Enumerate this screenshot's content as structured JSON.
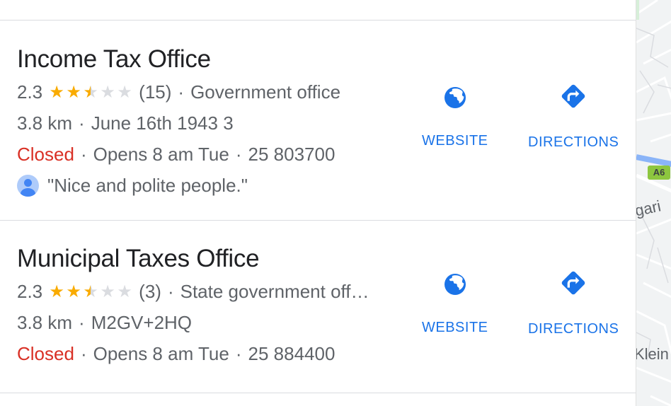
{
  "results": [
    {
      "name": "Income Tax Office",
      "rating": "2.3",
      "stars": [
        "full",
        "full",
        "half",
        "empty",
        "empty"
      ],
      "reviews": "(15)",
      "category": "Government office",
      "distance": "3.8 km",
      "address": "June 16th 1943 3",
      "status": "Closed",
      "hours": "Opens 8 am Tue",
      "phone": "25 803700",
      "review_snippet": "\"Nice and polite people.\"",
      "website_label": "WEBSITE",
      "directions_label": "DIRECTIONS"
    },
    {
      "name": "Municipal Taxes Office",
      "rating": "2.3",
      "stars": [
        "full",
        "full",
        "half",
        "empty",
        "empty"
      ],
      "reviews": "(3)",
      "category": "State government off…",
      "distance": "3.8 km",
      "address": "M2GV+2HQ",
      "status": "Closed",
      "hours": "Opens 8 am Tue",
      "phone": "25 884400",
      "website_label": "WEBSITE",
      "directions_label": "DIRECTIONS"
    }
  ],
  "separator": "·",
  "map": {
    "road_badge": "A6",
    "label_1": "gari",
    "label_2": "Klein"
  },
  "colors": {
    "accent": "#1a73e8",
    "closed": "#d93025",
    "star": "#f9ab00"
  }
}
